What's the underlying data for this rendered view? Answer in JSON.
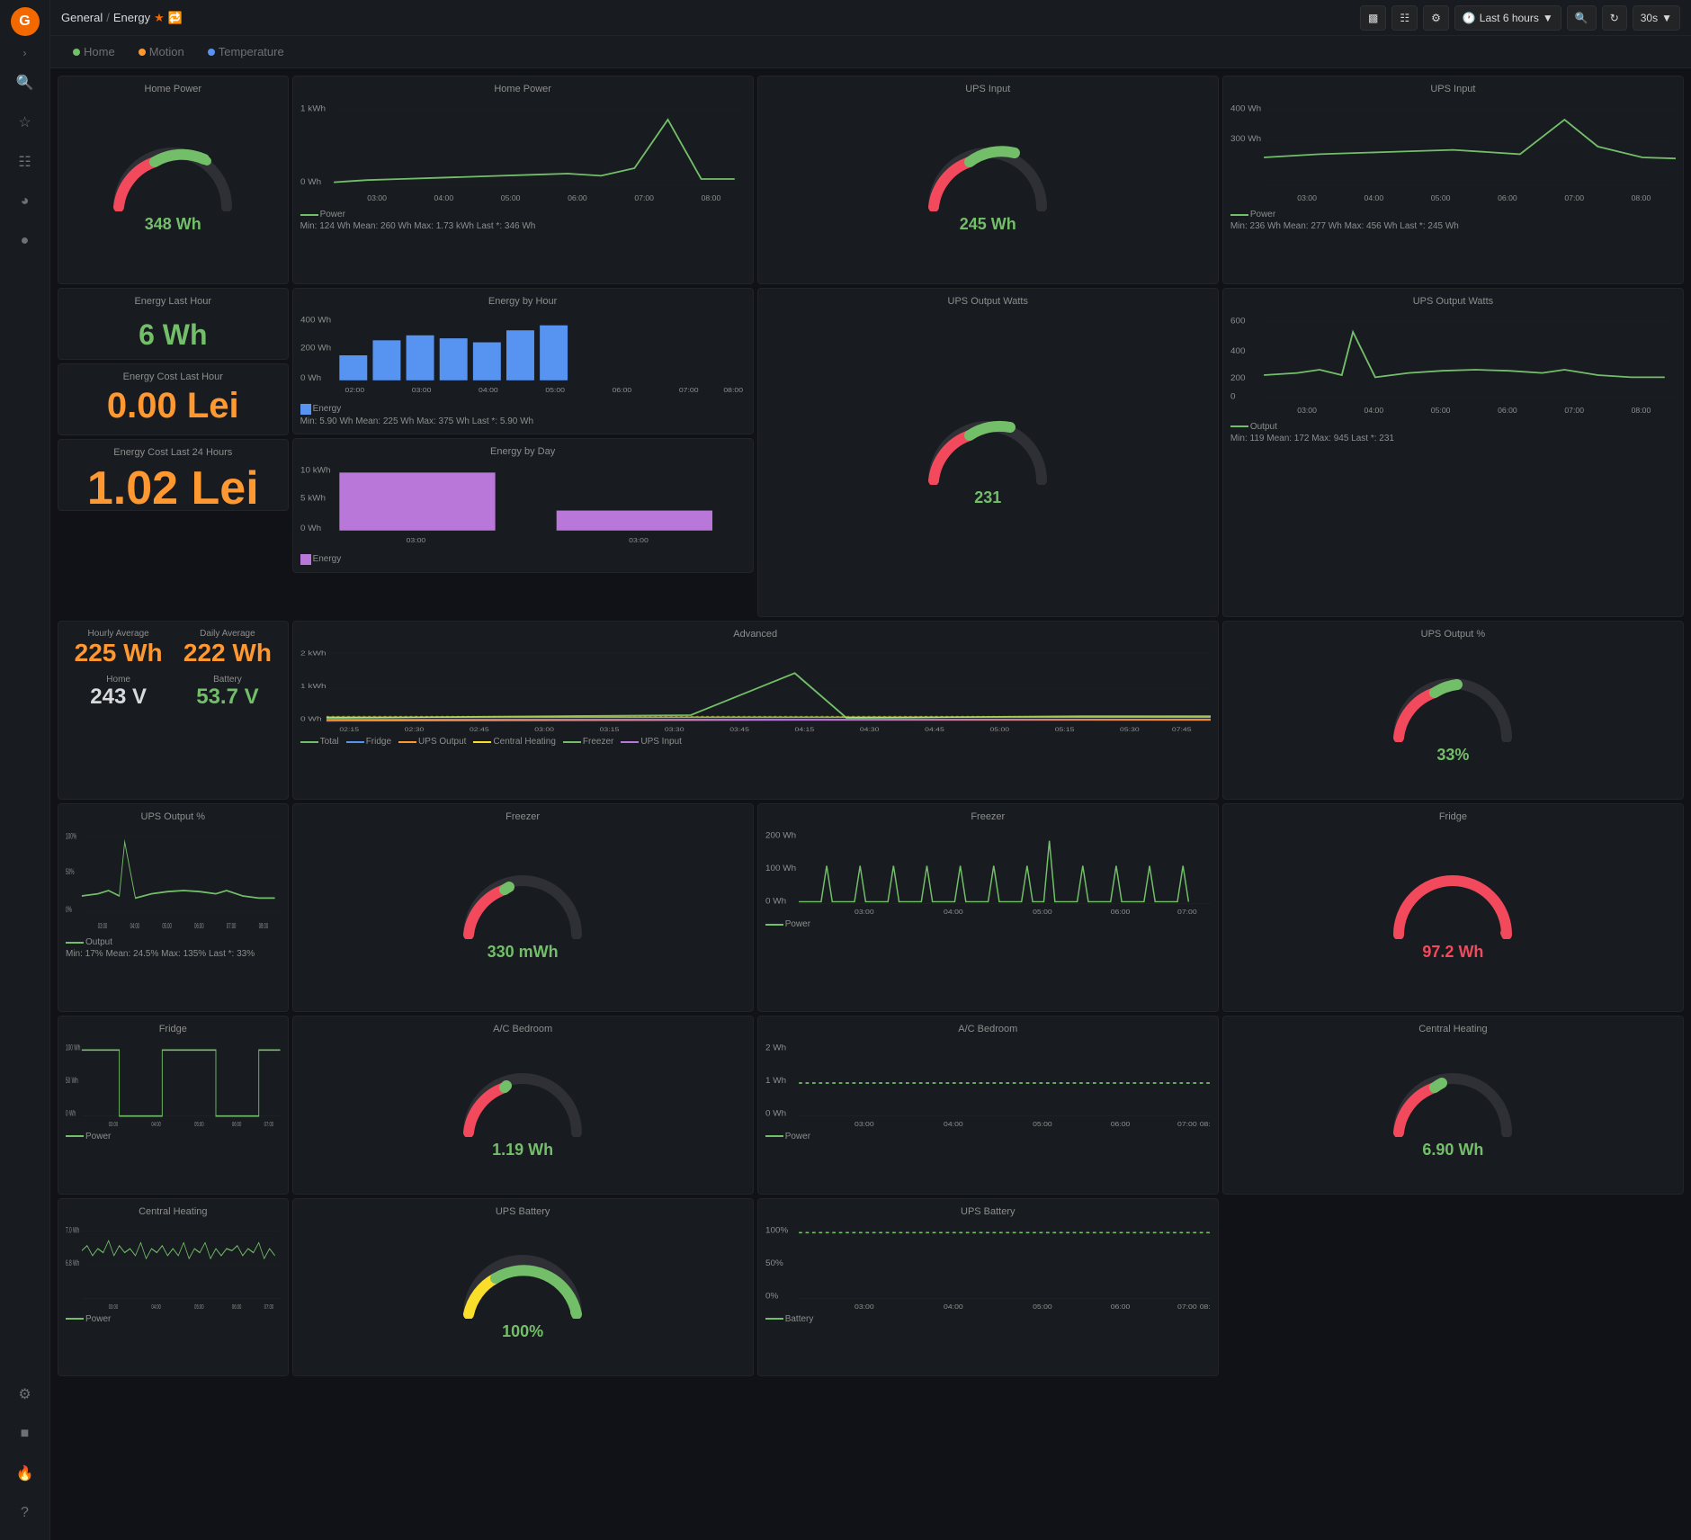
{
  "app": {
    "logo": "G",
    "breadcrumb": [
      "General",
      "Energy"
    ],
    "starred": true
  },
  "topbar": {
    "buttons": [
      "chart-icon",
      "table-icon",
      "settings-icon"
    ],
    "time_range": "Last 6 hours",
    "zoom_out": "zoom-out",
    "interval": "30s"
  },
  "nav_tabs": [
    {
      "id": "home",
      "label": "Home",
      "color": "#73bf69",
      "active": false
    },
    {
      "id": "motion",
      "label": "Motion",
      "color": "#ff9830",
      "active": false
    },
    {
      "id": "temperature",
      "label": "Temperature",
      "color": "#5794f2",
      "active": false
    }
  ],
  "cards": {
    "home_power": {
      "title": "Home Power",
      "value": "348 Wh",
      "legend_label": "Power",
      "meta": "Min: 124 Wh  Mean: 260 Wh  Max: 1.73 kWh  Last *: 346 Wh"
    },
    "energy_last_hour": {
      "title": "Energy Last Hour",
      "value": "6 Wh"
    },
    "energy_cost_last_hour": {
      "title": "Energy Cost Last Hour",
      "value": "0.00 Lei"
    },
    "energy_cost_last_24h": {
      "title": "Energy Cost Last 24 Hours",
      "value": "1.02 Lei"
    },
    "energy_by_hour": {
      "title": "Energy by Hour",
      "meta": "Min: 5.90 Wh  Mean: 225 Wh  Max: 375 Wh  Last *: 5.90 Wh"
    },
    "energy_by_day": {
      "title": "Energy by Day"
    },
    "ups_input": {
      "title": "UPS Input",
      "value": "245 Wh",
      "meta": "Min: 236 Wh  Mean: 277 Wh  Max: 456 Wh  Last *: 245 Wh"
    },
    "ups_input_chart": {
      "title": "UPS Input",
      "meta": "Min: 236 Wh  Mean: 277 Wh  Max: 456 Wh  Last *: 245 Wh"
    },
    "ups_output_watts": {
      "title": "UPS Output Watts",
      "value": "231",
      "meta": "Min: 119  Mean: 172  Max: 945  Last *: 231"
    },
    "ups_output_watts_chart": {
      "title": "UPS Output Watts",
      "meta": "Min: 119  Mean: 172  Max: 945  Last *: 231"
    },
    "ups_output_pct": {
      "title": "UPS Output %",
      "value": "33%",
      "meta": "Min: 17%  Mean: 24.5%  Max: 135%  Last *: 33%"
    },
    "ups_output_pct_chart": {
      "title": "UPS Output %",
      "meta": "Min: 17%  Mean: 24.5%  Max: 135%  Last *: 33%"
    },
    "hourly_avg": {
      "label": "Hourly Average",
      "value": "225 Wh"
    },
    "daily_avg": {
      "label": "Daily Average",
      "value": "222 Wh"
    },
    "home_voltage": {
      "label": "Home",
      "value": "243 V"
    },
    "battery_voltage": {
      "label": "Battery",
      "value": "53.7 V"
    },
    "advanced": {
      "title": "Advanced",
      "legend": [
        "Total",
        "Fridge",
        "UPS Output",
        "Central Heating",
        "Freezer",
        "UPS Input"
      ]
    },
    "freezer_gauge": {
      "title": "Freezer",
      "value": "330 mWh"
    },
    "freezer_chart": {
      "title": "Freezer",
      "meta": "Power"
    },
    "fridge_gauge": {
      "title": "Fridge",
      "value": "97.2 Wh"
    },
    "fridge_chart": {
      "title": "Fridge",
      "meta": "Power"
    },
    "ac_bedroom_gauge": {
      "title": "A/C Bedroom",
      "value": "1.19 Wh"
    },
    "ac_bedroom_chart": {
      "title": "A/C Bedroom",
      "meta": "Power"
    },
    "central_heating_gauge": {
      "title": "Central Heating",
      "value": "6.90 Wh"
    },
    "central_heating_chart": {
      "title": "Central Heating",
      "meta": "Power"
    },
    "ups_battery_gauge": {
      "title": "UPS Battery",
      "value": "100%"
    },
    "ups_battery_chart": {
      "title": "UPS Battery",
      "meta": "Battery"
    }
  },
  "colors": {
    "green": "#73bf69",
    "red": "#f2495c",
    "orange": "#ff9830",
    "blue": "#5794f2",
    "purple": "#b877d9",
    "yellow": "#fade2a",
    "teal": "#37872d",
    "dark_bg": "#181b1f",
    "border": "#222426",
    "text_dim": "#8e8e8e"
  }
}
